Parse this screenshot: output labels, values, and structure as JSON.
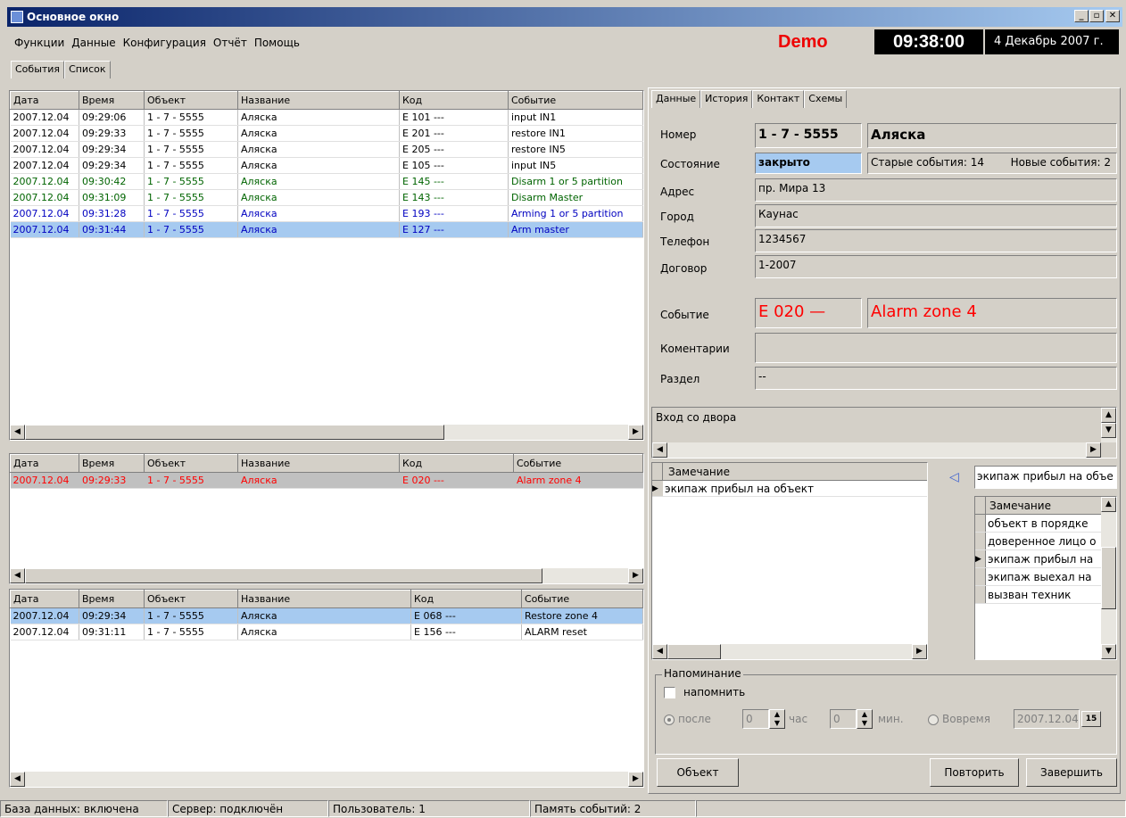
{
  "window": {
    "title": "Основное окно",
    "btn_min": "_",
    "btn_max": "▫",
    "btn_close": "✕"
  },
  "menu": [
    "Функции",
    "Данные",
    "Конфигурация",
    "Отчёт",
    "Помощь"
  ],
  "header": {
    "mode": "Demo",
    "clock": "09:38:00",
    "date": "4 Декабрь 2007 г."
  },
  "tabs": [
    "События",
    "Список"
  ],
  "columns": [
    "Дата",
    "Время",
    "Объект",
    "Название",
    "Код",
    "Событие"
  ],
  "events": [
    {
      "date": "2007.12.04",
      "time": "09:29:06",
      "obj": "1 - 7 - 5555",
      "name": "Аляска",
      "code": "E 101 ---",
      "event": "input IN1",
      "color": "#000000"
    },
    {
      "date": "2007.12.04",
      "time": "09:29:33",
      "obj": "1 - 7 - 5555",
      "name": "Аляска",
      "code": "E 201 ---",
      "event": "restore IN1",
      "color": "#000000"
    },
    {
      "date": "2007.12.04",
      "time": "09:29:34",
      "obj": "1 - 7 - 5555",
      "name": "Аляска",
      "code": "E 205 ---",
      "event": "restore IN5",
      "color": "#000000"
    },
    {
      "date": "2007.12.04",
      "time": "09:29:34",
      "obj": "1 - 7 - 5555",
      "name": "Аляска",
      "code": "E 105 ---",
      "event": "input IN5",
      "color": "#000000"
    },
    {
      "date": "2007.12.04",
      "time": "09:30:42",
      "obj": "1 - 7 - 5555",
      "name": "Аляска",
      "code": "E 145 ---",
      "event": "Disarm 1 or 5 partition",
      "color": "#006400"
    },
    {
      "date": "2007.12.04",
      "time": "09:31:09",
      "obj": "1 - 7 - 5555",
      "name": "Аляска",
      "code": "E 143 ---",
      "event": "Disarm Master",
      "color": "#006400"
    },
    {
      "date": "2007.12.04",
      "time": "09:31:28",
      "obj": "1 - 7 - 5555",
      "name": "Аляска",
      "code": "E 193 ---",
      "event": "Arming 1 or 5 partition",
      "color": "#0000c0"
    },
    {
      "date": "2007.12.04",
      "time": "09:31:44",
      "obj": "1 - 7 - 5555",
      "name": "Аляска",
      "code": "E 127 ---",
      "event": "Arm master",
      "color": "#0000c0",
      "selected": true
    }
  ],
  "alarms": [
    {
      "date": "2007.12.04",
      "time": "09:29:33",
      "obj": "1 - 7 - 5555",
      "name": "Аляска",
      "code": "E 020 ---",
      "event": "Alarm zone 4",
      "color": "#ff0000"
    }
  ],
  "restores": [
    {
      "date": "2007.12.04",
      "time": "09:29:34",
      "obj": "1 - 7 - 5555",
      "name": "Аляска",
      "code": "E 068 ---",
      "event": "Restore zone 4",
      "color": "#000000",
      "selected": true
    },
    {
      "date": "2007.12.04",
      "time": "09:31:11",
      "obj": "1 - 7 - 5555",
      "name": "Аляска",
      "code": "E 156 ---",
      "event": "ALARM reset",
      "color": "#000000"
    }
  ],
  "rtabs": [
    "Данные",
    "История",
    "Контакт",
    "Схемы"
  ],
  "details": {
    "number_label": "Номер",
    "number": "1 - 7 - 5555",
    "name": "Аляска",
    "state_label": "Состояние",
    "state": "закрыто",
    "old_events": "Старые события: 14",
    "new_events": "Новые события: 2",
    "address_label": "Адрес",
    "address": "пр. Мира 13",
    "city_label": "Город",
    "city": "Каунас",
    "phone_label": "Телефон",
    "phone": "1234567",
    "contract_label": "Договор",
    "contract": "1-2007",
    "event_label": "Событие",
    "event_code": "E 020 —",
    "event_name": "Alarm zone 4",
    "comment_label": "Коментарии",
    "comment": "",
    "section_label": "Раздел",
    "section": "--"
  },
  "note_text": "Вход со двора",
  "remarks": {
    "header": "Замечание",
    "rows": [
      "экипаж прибыл на объект"
    ]
  },
  "remark_input": "экипаж прибыл на объе",
  "remark_options": {
    "header": "Замечание",
    "rows": [
      "объект в порядке",
      "доверенное лицо о",
      "экипаж прибыл на",
      "экипаж выехал на",
      "вызван техник"
    ],
    "current": 2
  },
  "reminder": {
    "legend": "Напоминание",
    "check_label": "напомнить",
    "after_label": "после",
    "hours_value": "0",
    "hours_label": "час",
    "min_value": "0",
    "min_label": "мин.",
    "ontime_label": "Вовремя",
    "date_value": "2007.12.04",
    "cal_icon": "15"
  },
  "buttons": {
    "object": "Объект",
    "repeat": "Повторить",
    "finish": "Завершить"
  },
  "status": [
    "База данных: включена",
    "Сервер: подключён",
    "Пользователь: 1",
    "Память событий: 2"
  ]
}
